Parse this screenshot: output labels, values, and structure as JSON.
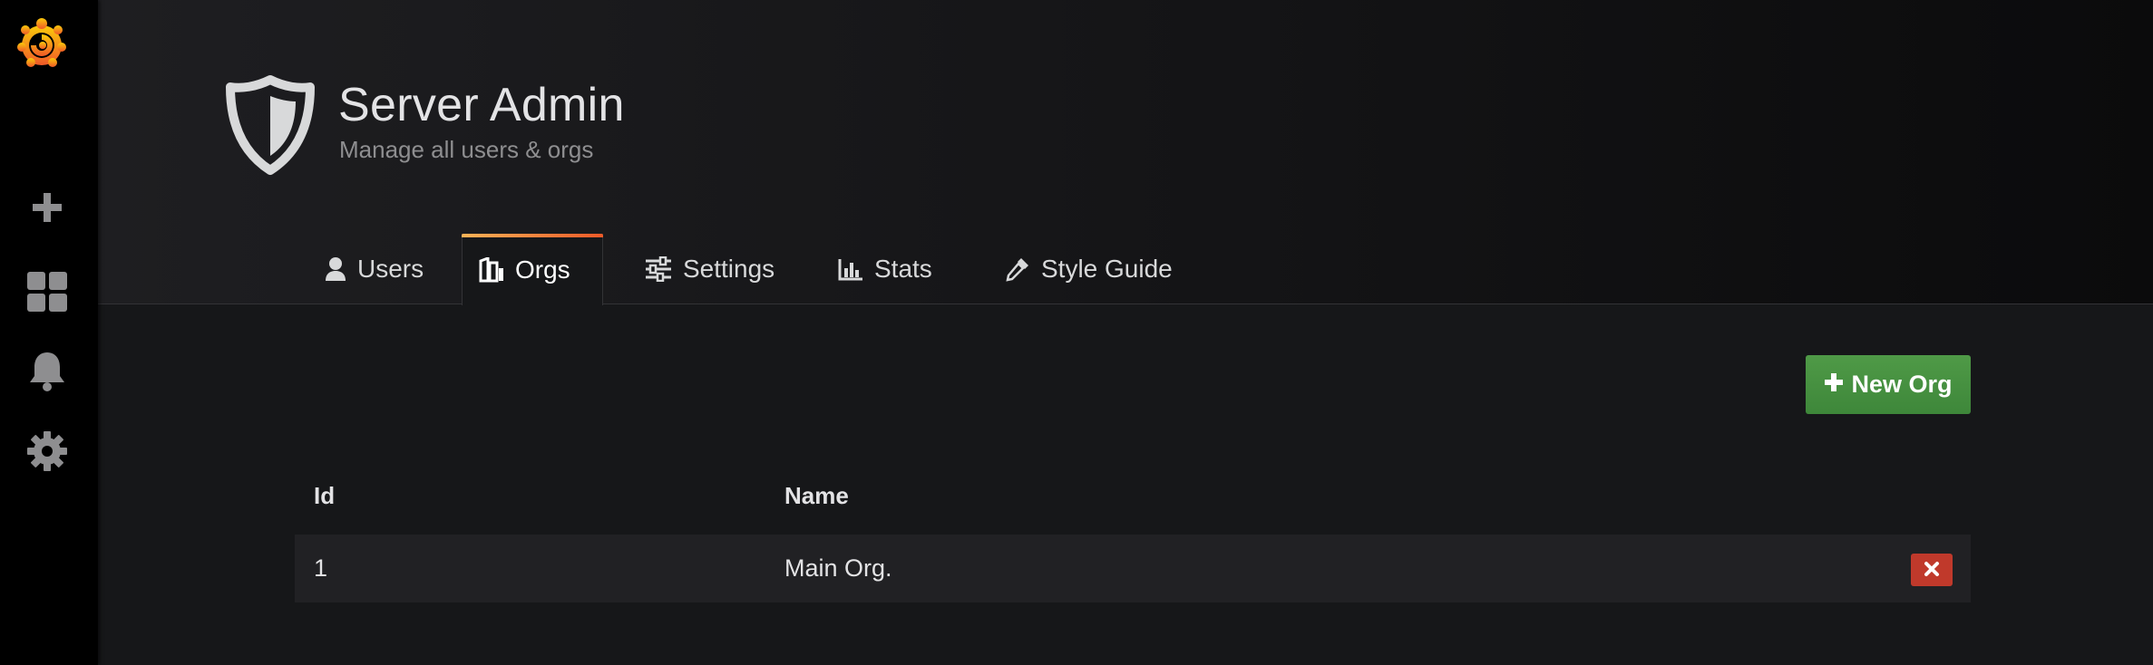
{
  "sidebar": {
    "logo": "grafana-logo",
    "items": [
      {
        "icon": "plus-icon",
        "name": "create"
      },
      {
        "icon": "dashboards-icon",
        "name": "dashboards"
      },
      {
        "icon": "bell-icon",
        "name": "alerting"
      },
      {
        "icon": "gear-icon",
        "name": "configuration"
      }
    ]
  },
  "header": {
    "icon": "shield-icon",
    "title": "Server Admin",
    "subtitle": "Manage all users & orgs"
  },
  "tabs": [
    {
      "label": "Users",
      "icon": "user-icon",
      "active": false
    },
    {
      "label": "Orgs",
      "icon": "orgs-icon",
      "active": true
    },
    {
      "label": "Settings",
      "icon": "sliders-icon",
      "active": false
    },
    {
      "label": "Stats",
      "icon": "bar-chart-icon",
      "active": false
    },
    {
      "label": "Style Guide",
      "icon": "eyedropper-icon",
      "active": false
    }
  ],
  "actions": {
    "new_org_label": "New Org"
  },
  "table": {
    "columns": [
      "Id",
      "Name"
    ],
    "rows": [
      {
        "id": "1",
        "name": "Main Org."
      }
    ]
  },
  "colors": {
    "primary_button": "#3e873a",
    "danger_button": "#c0392b",
    "active_tab_accent": "#f05a28"
  }
}
